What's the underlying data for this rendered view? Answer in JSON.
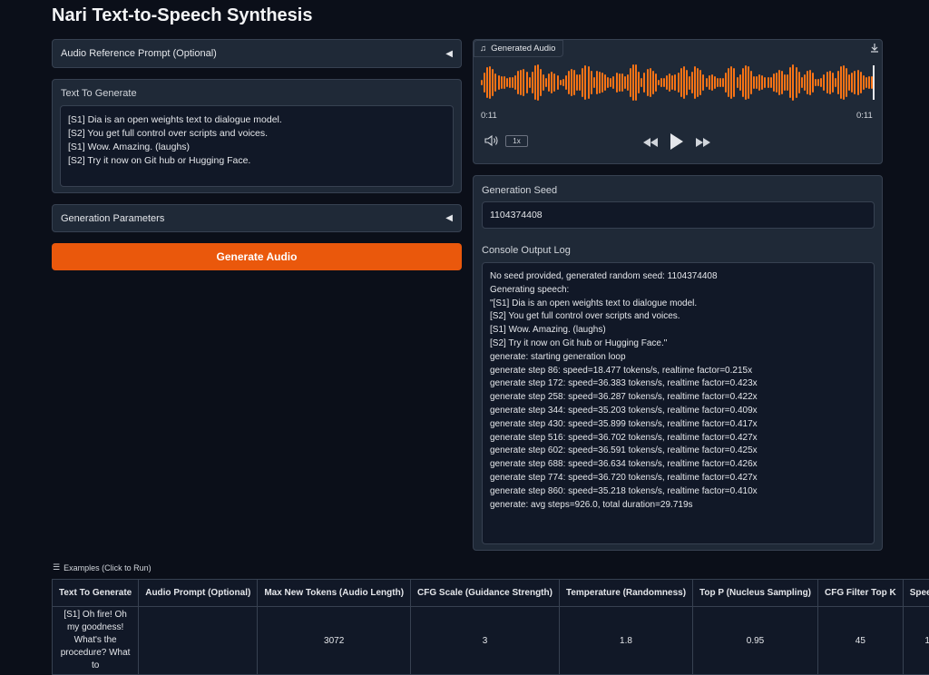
{
  "app": {
    "title": "Nari Text-to-Speech Synthesis"
  },
  "left": {
    "audio_ref": {
      "label": "Audio Reference Prompt (Optional)",
      "caret": "◀"
    },
    "text_box": {
      "label": "Text To Generate",
      "lines": [
        "[S1] Dia is an open weights text to dialogue model.",
        "[S2] You get full control over scripts and voices.",
        "[S1] Wow. Amazing. (laughs)",
        "[S2] Try it now on Git hub or Hugging Face."
      ]
    },
    "gen_params": {
      "label": "Generation Parameters",
      "caret": "◀"
    },
    "generate_button": "Generate Audio"
  },
  "audio": {
    "tag_label": "Generated Audio",
    "time_current": "0:11",
    "time_total": "0:11",
    "speed": "1x",
    "accent": "#f97316"
  },
  "seed": {
    "label": "Generation Seed",
    "value": "1104374408"
  },
  "console": {
    "label": "Console Output Log",
    "lines": [
      "",
      "No seed provided, generated random seed: 1104374408",
      "",
      "Generating speech:",
      "\"[S1] Dia is an open weights text to dialogue model.",
      "[S2] You get full control over scripts and voices.",
      "[S1] Wow. Amazing. (laughs)",
      "[S2] Try it now on Git hub or Hugging Face.\"",
      "",
      "generate: starting generation loop",
      "generate step 86: speed=18.477 tokens/s, realtime factor=0.215x",
      "generate step 172: speed=36.383 tokens/s, realtime factor=0.423x",
      "generate step 258: speed=36.287 tokens/s, realtime factor=0.422x",
      "generate step 344: speed=35.203 tokens/s, realtime factor=0.409x",
      "generate step 430: speed=35.899 tokens/s, realtime factor=0.417x",
      "generate step 516: speed=36.702 tokens/s, realtime factor=0.427x",
      "generate step 602: speed=36.591 tokens/s, realtime factor=0.425x",
      "generate step 688: speed=36.634 tokens/s, realtime factor=0.426x",
      "generate step 774: speed=36.720 tokens/s, realtime factor=0.427x",
      "generate step 860: speed=35.218 tokens/s, realtime factor=0.410x",
      "generate: avg steps=926.0, total duration=29.719s"
    ]
  },
  "examples": {
    "label": "Examples (Click to Run)",
    "headers": [
      "Text To Generate",
      "Audio Prompt (Optional)",
      "Max New Tokens (Audio Length)",
      "CFG Scale (Guidance Strength)",
      "Temperature (Randomness)",
      "Top P (Nucleus Sampling)",
      "CFG Filter Top K",
      "Speed F"
    ],
    "row": [
      "[S1] Oh fire! Oh my goodness! What's the procedure? What to",
      "",
      "3072",
      "3",
      "1.8",
      "0.95",
      "45",
      "1"
    ]
  }
}
